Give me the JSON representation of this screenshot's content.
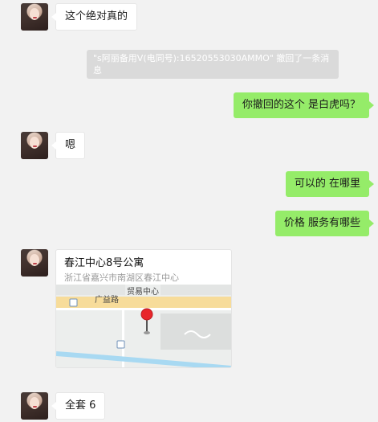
{
  "messages": {
    "m1": "这个绝对真的",
    "system_recall": "\"s阿丽备用V(电同号):16520553030AMMO\" 撤回了一条消息",
    "m2": "你撤回的这个 是白虎吗？",
    "m3": "嗯",
    "m4": "可以的 在哪里",
    "m5": "价格 服务有哪些",
    "m6": "全套    6"
  },
  "location": {
    "title": "春江中心8号公寓",
    "address": "浙江省嘉兴市南湖区春江中心",
    "road_1": "贸易中心",
    "road_2": "广益路"
  },
  "colors": {
    "background": "#f2f2f2",
    "outgoing_bubble": "#95ec69",
    "incoming_bubble": "#ffffff",
    "system_notice": "#dadada",
    "map_pin": "#e8262b"
  },
  "icons": {
    "avatar": "avatar-photo",
    "map_pin": "map-pin-icon",
    "bus_stop": "bus-stop-icon"
  }
}
